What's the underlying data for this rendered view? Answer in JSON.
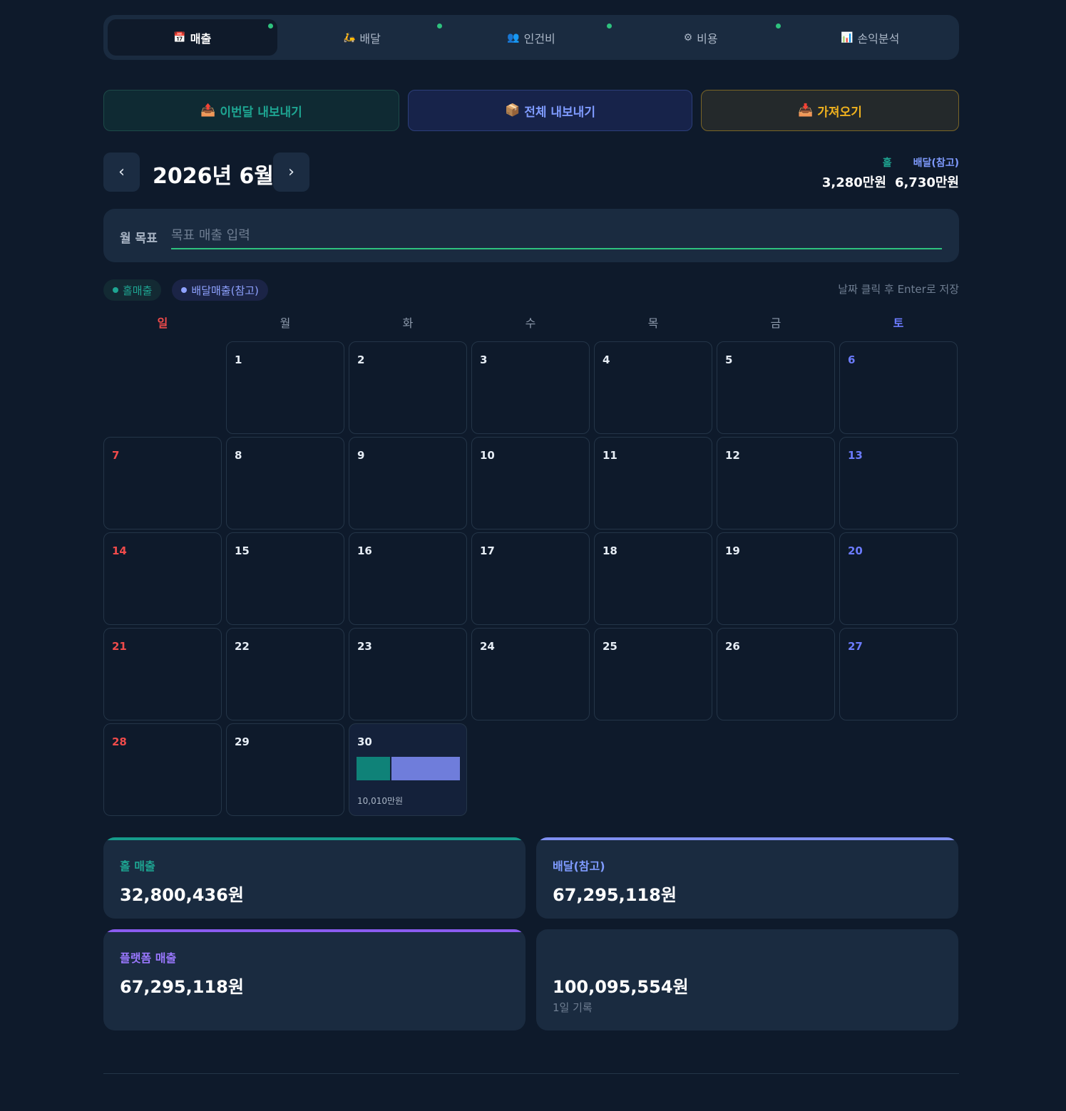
{
  "tabs": [
    {
      "icon": "📅",
      "icon_name": "calendar-icon",
      "label": "매출",
      "active": true,
      "dot": true
    },
    {
      "icon": "🛵",
      "icon_name": "scooter-icon",
      "label": "배달",
      "active": false,
      "dot": true
    },
    {
      "icon": "👥",
      "icon_name": "people-icon",
      "label": "인건비",
      "active": false,
      "dot": true
    },
    {
      "icon": "⚙",
      "icon_name": "gear-icon",
      "label": "비용",
      "active": false,
      "dot": true
    },
    {
      "icon": "📊",
      "icon_name": "bar-chart-icon",
      "label": "손익분석",
      "active": false,
      "dot": false
    }
  ],
  "actions": {
    "export_month": {
      "icon": "📤",
      "label": "이번달 내보내기"
    },
    "export_all": {
      "icon": "📦",
      "label": "전체 내보내기"
    },
    "import": {
      "icon": "📥",
      "label": "가져오기"
    }
  },
  "month": {
    "title": "2026년 6월",
    "prev": "‹",
    "next": "›"
  },
  "summary": {
    "hall_label": "홀",
    "delivery_label": "배달(참고)",
    "hall_value": "3,280만원",
    "delivery_value": "6,730만원"
  },
  "goal": {
    "label": "월 목표",
    "placeholder": "목표 매출 입력",
    "value": ""
  },
  "legend": {
    "hall": "홀매출",
    "delivery": "배달매출(참고)"
  },
  "hint": "날짜 클릭 후 Enter로 저장",
  "weekdays": [
    "일",
    "월",
    "화",
    "수",
    "목",
    "금",
    "토"
  ],
  "calendar": {
    "first_weekday": 1,
    "days": 30,
    "entries": {
      "30": {
        "hall_share": 0.327,
        "delivery_share": 0.673,
        "amount": "10,010만원"
      }
    }
  },
  "stats": {
    "hall": {
      "label": "홀 매출",
      "value": "32,800,436원",
      "accent": "#169c8c"
    },
    "delivery": {
      "label": "배달(참고)",
      "value": "67,295,118원",
      "accent": "#7f8ff0"
    },
    "platform": {
      "label": "플랫폼 매출",
      "value": "67,295,118원",
      "accent": "#8a5cf0"
    },
    "total": {
      "value": "100,095,554원",
      "sub": "1일 기록"
    }
  },
  "colors": {
    "background": "#0e1a2b",
    "panel": "#1a2b40",
    "hall": "#0f8278",
    "delivery": "#6f7ddb",
    "sunday": "#f04b4b",
    "saturday": "#6c7cff",
    "active_dot": "#2ec27e"
  }
}
